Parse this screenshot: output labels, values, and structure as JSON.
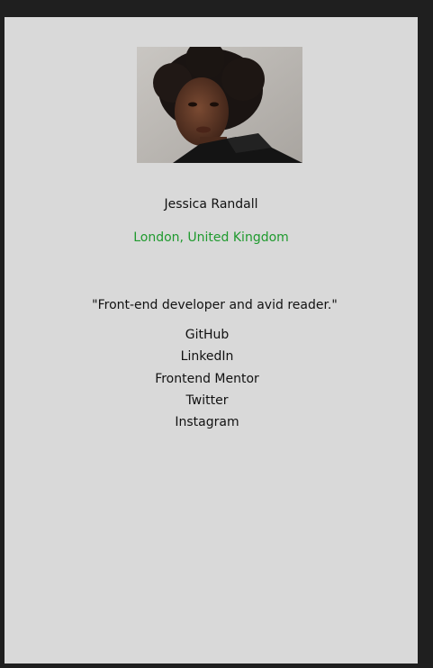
{
  "profile": {
    "photo_alt": "Jessica Randall portrait",
    "name": "Jessica Randall",
    "location": "London, United Kingdom",
    "bio": "\"Front-end developer and avid reader.\"",
    "links": [
      {
        "label": "GitHub"
      },
      {
        "label": "LinkedIn"
      },
      {
        "label": "Frontend Mentor"
      },
      {
        "label": "Twitter"
      },
      {
        "label": "Instagram"
      }
    ]
  },
  "colors": {
    "page_background": "#1f1f1f",
    "card_background": "#d9d9d9",
    "location_accent": "#1f9a2e",
    "text": "#111111"
  }
}
